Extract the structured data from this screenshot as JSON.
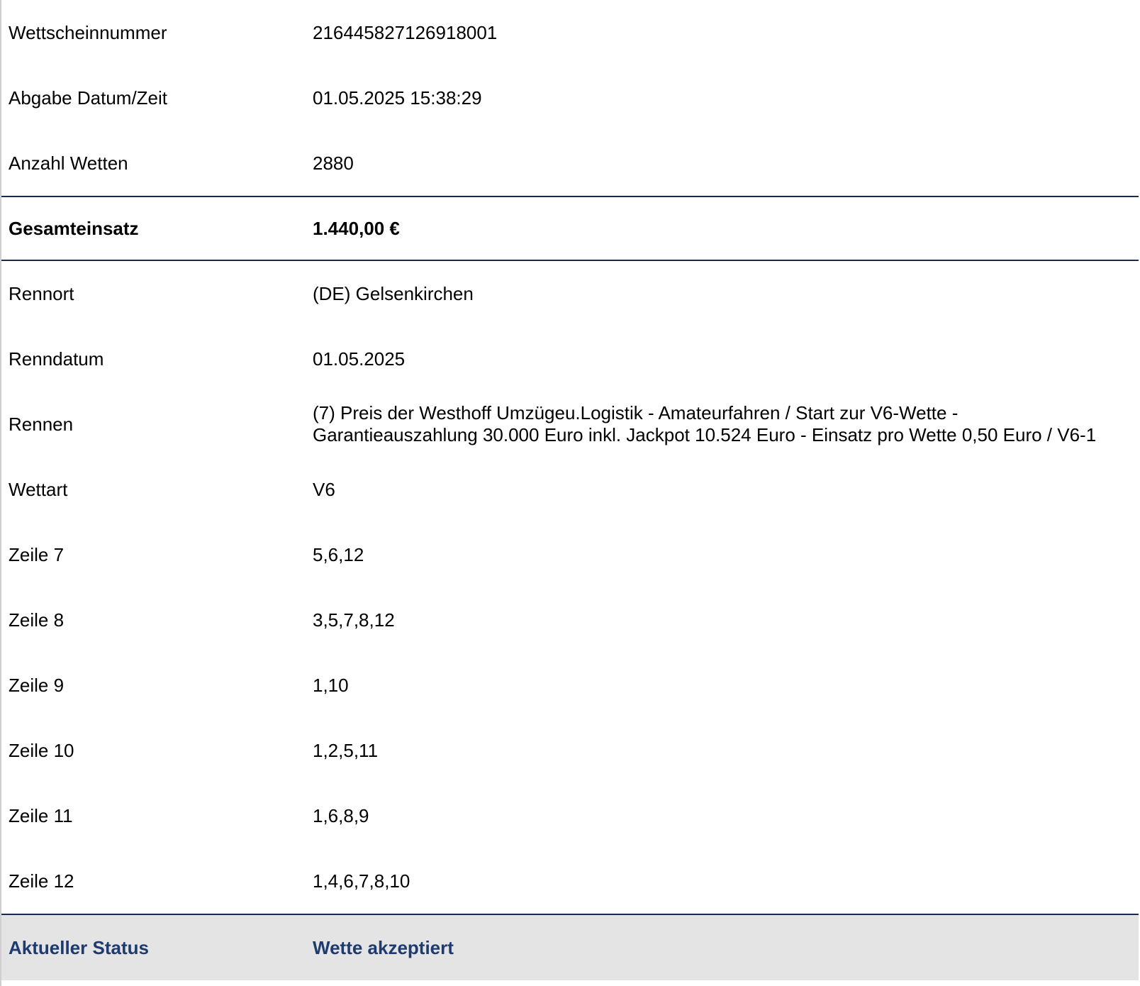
{
  "ticket": {
    "number": {
      "label": "Wettscheinnummer",
      "value": "216445827126918001"
    },
    "submitted": {
      "label": "Abgabe Datum/Zeit",
      "value": "01.05.2025 15:38:29"
    },
    "bet_count": {
      "label": "Anzahl Wetten",
      "value": "2880"
    },
    "total_stake": {
      "label": "Gesamteinsatz",
      "value": "1.440,00 €"
    },
    "venue": {
      "label": "Rennort",
      "value": "(DE) Gelsenkirchen"
    },
    "race_date": {
      "label": "Renndatum",
      "value": "01.05.2025"
    },
    "race": {
      "label": "Rennen",
      "value_line1": "(7) Preis der Westhoff Umzügeu.Logistik - Amateurfahren / Start zur V6-Wette -",
      "value_line2": "Garantieauszahlung 30.000 Euro inkl. Jackpot 10.524 Euro - Einsatz pro Wette 0,50 Euro / V6-1"
    },
    "bet_type": {
      "label": "Wettart",
      "value": "V6"
    },
    "lines": [
      {
        "label": "Zeile 7",
        "value": "5,6,12"
      },
      {
        "label": "Zeile 8",
        "value": "3,5,7,8,12"
      },
      {
        "label": "Zeile 9",
        "value": "1,10"
      },
      {
        "label": "Zeile 10",
        "value": "1,2,5,11"
      },
      {
        "label": "Zeile 11",
        "value": "1,6,8,9"
      },
      {
        "label": "Zeile 12",
        "value": "1,4,6,7,8,10"
      }
    ],
    "status": {
      "label": "Aktueller Status",
      "value": "Wette akzeptiert"
    }
  },
  "colors": {
    "divider": "#1b2a4a",
    "status_text": "#1e3a6e",
    "status_background": "#e4e4e4"
  }
}
